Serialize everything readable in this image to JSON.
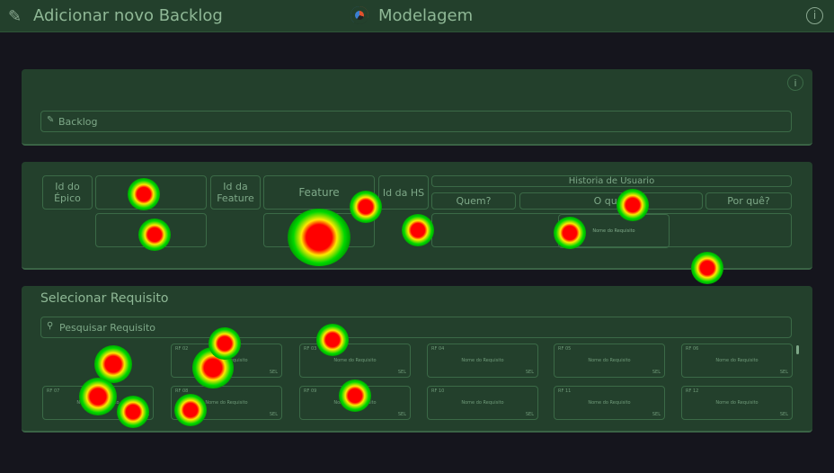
{
  "header": {
    "back_icon": "tool-icon",
    "title": "Adicionar novo Backlog",
    "app_name": "Modelagem",
    "info_icon": "info-icon"
  },
  "backlog_panel": {
    "info_icon": "info-icon",
    "input_icon": "edit-icon",
    "input_placeholder": "Backlog"
  },
  "form": {
    "epic_id_label": "Id do Épico",
    "feature_id_label": "Id da Feature",
    "feature_label": "Feature",
    "hs_id_label": "Id da HS",
    "user_story_label": "Historia de Usuario",
    "who_label": "Quem?",
    "what_label": "O que?",
    "why_label": "Por quê?",
    "mini_card_text": "Nome do Requisito"
  },
  "requirements": {
    "title": "Selecionar Requisito",
    "search_icon": "search-icon",
    "search_placeholder": "Pesquisar Requisito",
    "cards": [
      {
        "id": "RF 02",
        "name": "Nome do Requisito",
        "btn": "SEL"
      },
      {
        "id": "RF 03",
        "name": "Nome do Requisito",
        "btn": "SEL"
      },
      {
        "id": "RF 04",
        "name": "Nome do Requisito",
        "btn": "SEL"
      },
      {
        "id": "RF 05",
        "name": "Nome do Requisito",
        "btn": "SEL"
      },
      {
        "id": "RF 06",
        "name": "Nome do Requisito",
        "btn": "SEL"
      },
      {
        "id": "RF 07",
        "name": "Nome do Requisito",
        "btn": "SEL"
      },
      {
        "id": "RF 08",
        "name": "Nome do Requisito",
        "btn": "SEL"
      },
      {
        "id": "RF 09",
        "name": "Nome do Requisito",
        "btn": "SEL"
      },
      {
        "id": "RF 10",
        "name": "Nome do Requisito",
        "btn": "SEL"
      },
      {
        "id": "RF 11",
        "name": "Nome do Requisito",
        "btn": "SEL"
      },
      {
        "id": "RF 12",
        "name": "Nome do Requisito",
        "btn": "SEL"
      }
    ]
  }
}
